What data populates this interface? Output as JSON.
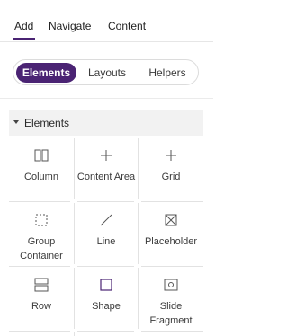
{
  "top_tabs": {
    "add": "Add",
    "navigate": "Navigate",
    "content": "Content"
  },
  "segmented": {
    "elements": "Elements",
    "layouts": "Layouts",
    "helpers": "Helpers"
  },
  "section": {
    "title": "Elements"
  },
  "tiles": [
    {
      "label": "Column",
      "icon": "column-icon"
    },
    {
      "label": "Content Area",
      "icon": "plus-icon"
    },
    {
      "label": "Grid",
      "icon": "plus-icon"
    },
    {
      "label": "Group Container",
      "icon": "dashed-square-icon"
    },
    {
      "label": "Line",
      "icon": "line-icon"
    },
    {
      "label": "Placeholder",
      "icon": "placeholder-icon"
    },
    {
      "label": "Row",
      "icon": "row-icon"
    },
    {
      "label": "Shape",
      "icon": "square-icon"
    },
    {
      "label": "Slide Fragment",
      "icon": "slide-fragment-icon"
    }
  ],
  "colors": {
    "accent": "#4a2373"
  }
}
